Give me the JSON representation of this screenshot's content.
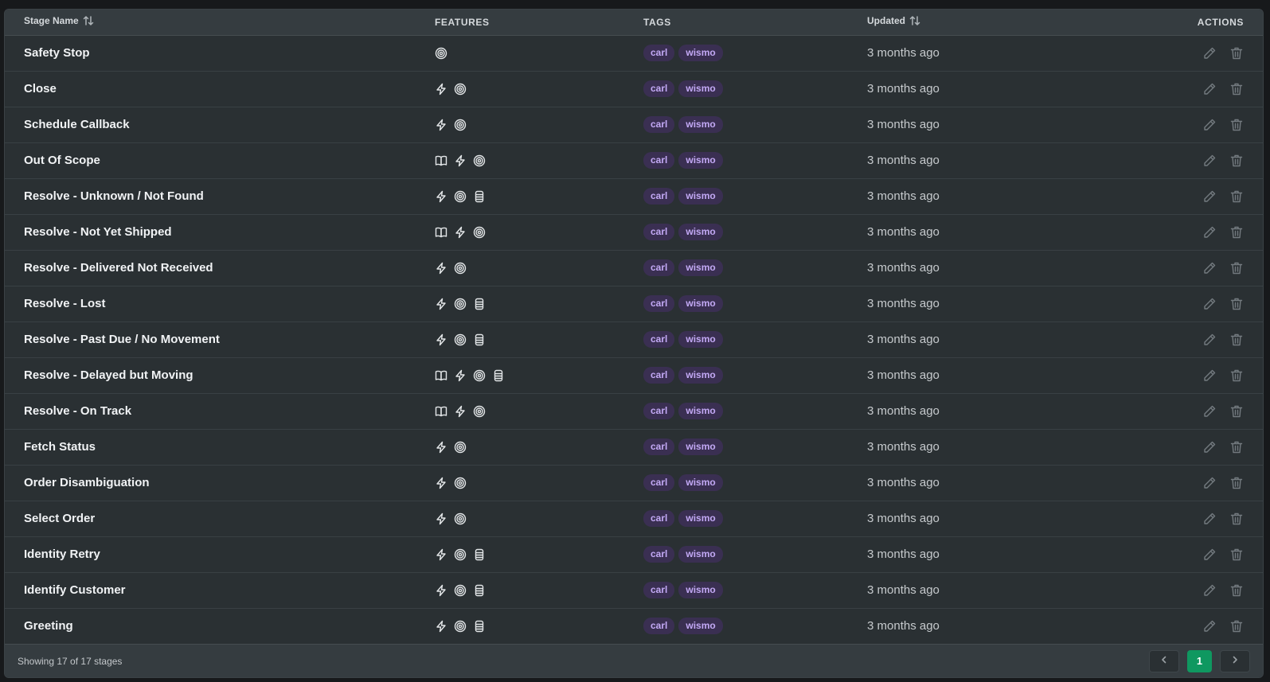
{
  "columns": {
    "name": "Stage Name",
    "features": "FEATURES",
    "tags": "TAGS",
    "updated": "Updated",
    "actions": "ACTIONS"
  },
  "rows": [
    {
      "name": "Safety Stop",
      "features": [
        "target-icon"
      ],
      "tags": [
        "carl",
        "wismo"
      ],
      "updated": "3 months ago"
    },
    {
      "name": "Close",
      "features": [
        "lightning-icon",
        "target-icon"
      ],
      "tags": [
        "carl",
        "wismo"
      ],
      "updated": "3 months ago"
    },
    {
      "name": "Schedule Callback",
      "features": [
        "lightning-icon",
        "target-icon"
      ],
      "tags": [
        "carl",
        "wismo"
      ],
      "updated": "3 months ago"
    },
    {
      "name": "Out Of Scope",
      "features": [
        "book-icon",
        "lightning-icon",
        "target-icon"
      ],
      "tags": [
        "carl",
        "wismo"
      ],
      "updated": "3 months ago"
    },
    {
      "name": "Resolve - Unknown / Not Found",
      "features": [
        "lightning-icon",
        "target-icon",
        "database-icon"
      ],
      "tags": [
        "carl",
        "wismo"
      ],
      "updated": "3 months ago"
    },
    {
      "name": "Resolve - Not Yet Shipped",
      "features": [
        "book-icon",
        "lightning-icon",
        "target-icon"
      ],
      "tags": [
        "carl",
        "wismo"
      ],
      "updated": "3 months ago"
    },
    {
      "name": "Resolve - Delivered Not Received",
      "features": [
        "lightning-icon",
        "target-icon"
      ],
      "tags": [
        "carl",
        "wismo"
      ],
      "updated": "3 months ago"
    },
    {
      "name": "Resolve - Lost",
      "features": [
        "lightning-icon",
        "target-icon",
        "database-icon"
      ],
      "tags": [
        "carl",
        "wismo"
      ],
      "updated": "3 months ago"
    },
    {
      "name": "Resolve - Past Due / No Movement",
      "features": [
        "lightning-icon",
        "target-icon",
        "database-icon"
      ],
      "tags": [
        "carl",
        "wismo"
      ],
      "updated": "3 months ago"
    },
    {
      "name": "Resolve - Delayed but Moving",
      "features": [
        "book-icon",
        "lightning-icon",
        "target-icon",
        "database-icon"
      ],
      "tags": [
        "carl",
        "wismo"
      ],
      "updated": "3 months ago"
    },
    {
      "name": "Resolve - On Track",
      "features": [
        "book-icon",
        "lightning-icon",
        "target-icon"
      ],
      "tags": [
        "carl",
        "wismo"
      ],
      "updated": "3 months ago"
    },
    {
      "name": "Fetch Status",
      "features": [
        "lightning-icon",
        "target-icon"
      ],
      "tags": [
        "carl",
        "wismo"
      ],
      "updated": "3 months ago"
    },
    {
      "name": "Order Disambiguation",
      "features": [
        "lightning-icon",
        "target-icon"
      ],
      "tags": [
        "carl",
        "wismo"
      ],
      "updated": "3 months ago"
    },
    {
      "name": "Select Order",
      "features": [
        "lightning-icon",
        "target-icon"
      ],
      "tags": [
        "carl",
        "wismo"
      ],
      "updated": "3 months ago"
    },
    {
      "name": "Identity Retry",
      "features": [
        "lightning-icon",
        "target-icon",
        "database-icon"
      ],
      "tags": [
        "carl",
        "wismo"
      ],
      "updated": "3 months ago"
    },
    {
      "name": "Identify Customer",
      "features": [
        "lightning-icon",
        "target-icon",
        "database-icon"
      ],
      "tags": [
        "carl",
        "wismo"
      ],
      "updated": "3 months ago"
    },
    {
      "name": "Greeting",
      "features": [
        "lightning-icon",
        "target-icon",
        "database-icon"
      ],
      "tags": [
        "carl",
        "wismo"
      ],
      "updated": "3 months ago"
    }
  ],
  "footer": {
    "summary": "Showing 17 of 17 stages",
    "current_page": "1"
  },
  "colors": {
    "accent": "#0f9860",
    "tag_bg": "#3a2f52",
    "tag_text": "#c3a9f5"
  }
}
